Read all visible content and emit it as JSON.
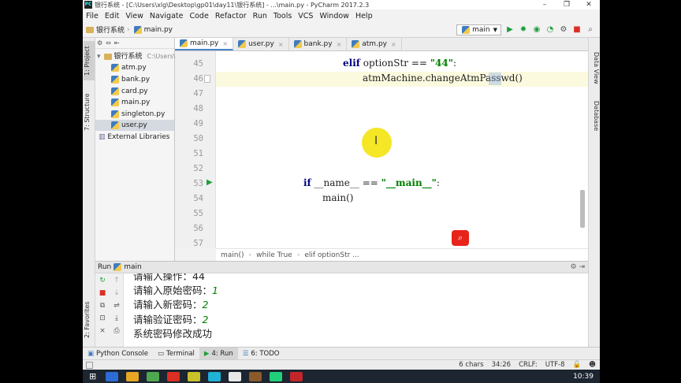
{
  "window": {
    "title": "银行系统 - [C:\\Users\\xlg\\Desktop\\gp01\\day11\\银行系统] - ...\\main.py - PyCharm 2017.2.3",
    "minimize": "–",
    "maximize": "❐",
    "close": "✕"
  },
  "menu": [
    "File",
    "Edit",
    "View",
    "Navigate",
    "Code",
    "Refactor",
    "Run",
    "Tools",
    "VCS",
    "Window",
    "Help"
  ],
  "nav": {
    "project": "银行系统",
    "file": "main.py",
    "run_config": "main"
  },
  "left_tabs": {
    "project": "1: Project",
    "structure": "7: Structure",
    "favorites": "2: Favorites"
  },
  "right_tabs": {
    "data_view": "Data View",
    "database": "Database"
  },
  "project_tree": {
    "root": "银行系统",
    "root_path": "C:\\Users\\xl",
    "files": [
      "atm.py",
      "bank.py",
      "card.py",
      "main.py",
      "singleton.py",
      "user.py"
    ],
    "selected": "user.py",
    "external": "External Libraries"
  },
  "editor_tabs": [
    "main.py",
    "user.py",
    "bank.py",
    "atm.py"
  ],
  "editor_active_tab": "main.py",
  "code": {
    "line_numbers": [
      "45",
      "46",
      "47",
      "48",
      "49",
      "50",
      "51",
      "52",
      "53",
      "54",
      "55",
      "56",
      "57"
    ],
    "l45_kw": "elif",
    "l45_mid": " optionStr == ",
    "l45_str": "\"44\"",
    "l45_end": ":",
    "l46": "atmMachine.changeAtmPasswd()",
    "l53_kw": "if",
    "l53_mid": " __name__ == ",
    "l53_str": "\"__main__\"",
    "l53_end": ":",
    "l54": "main()"
  },
  "breadcrumb": [
    "main()",
    "while True",
    "elif optionStr ..."
  ],
  "run_panel": {
    "label": "Run",
    "config": "main"
  },
  "console": [
    {
      "text": "请输入操作：44",
      "input": ""
    },
    {
      "text": "请输入原始密码：",
      "input": "1"
    },
    {
      "text": "请输入新密码：",
      "input": "2"
    },
    {
      "text": "请输验证密码：",
      "input": "2"
    },
    {
      "text": "系统密码修改成功",
      "input": ""
    }
  ],
  "bottom_tabs": [
    "Python Console",
    "Terminal",
    "4: Run",
    "6: TODO"
  ],
  "bottom_active": "4: Run",
  "status": {
    "chars": "6 chars",
    "position": "34:26",
    "line_sep": "CRLF:",
    "encoding": "UTF-8"
  },
  "taskbar": {
    "time": "10:39"
  },
  "colors": {
    "keyword": "#000080",
    "string": "#008000",
    "current_line": "#fcfade",
    "run_green": "#1f9e3a",
    "stop_red": "#d93025"
  }
}
